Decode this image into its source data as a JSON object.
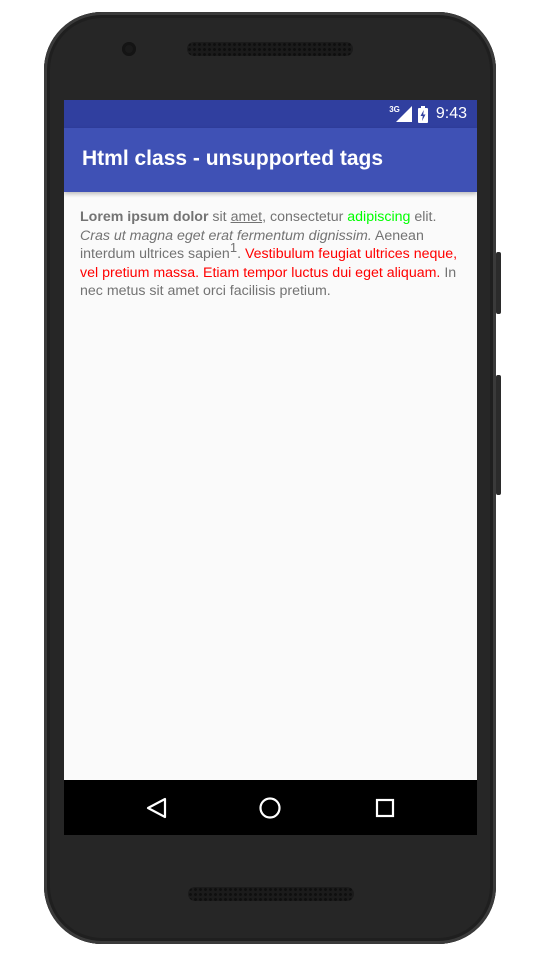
{
  "status_bar": {
    "network_type": "3G",
    "time": "9:43",
    "signal_icon": "cellular-signal-icon",
    "battery_icon": "battery-charging-icon",
    "color": "#303f9f"
  },
  "app_bar": {
    "title": "Html class - unsupported tags",
    "color": "#3f51b5"
  },
  "content": {
    "seg_bold": "Lorem ipsum dolor",
    "seg_1": " sit ",
    "seg_underline": "amet",
    "seg_2": ", consectetur ",
    "seg_green": "adipiscing",
    "seg_3": " elit. ",
    "seg_italic": "Cras ut magna eget erat fermentum dignissim.",
    "seg_4": " Aenean interdum ultrices sapien",
    "seg_sup": "1",
    "seg_5": ". ",
    "seg_red": "Vestibulum feugiat ultrices neque, vel pretium massa. Etiam tempor luctus dui eget aliquam.",
    "seg_6": " In nec metus sit amet orci facilisis pretium.",
    "colors": {
      "text": "#737373",
      "green": "#00ff00",
      "red": "#ff0000"
    }
  },
  "nav_bar": {
    "back_icon": "back-triangle-icon",
    "home_icon": "home-circle-icon",
    "recents_icon": "recents-square-icon"
  }
}
